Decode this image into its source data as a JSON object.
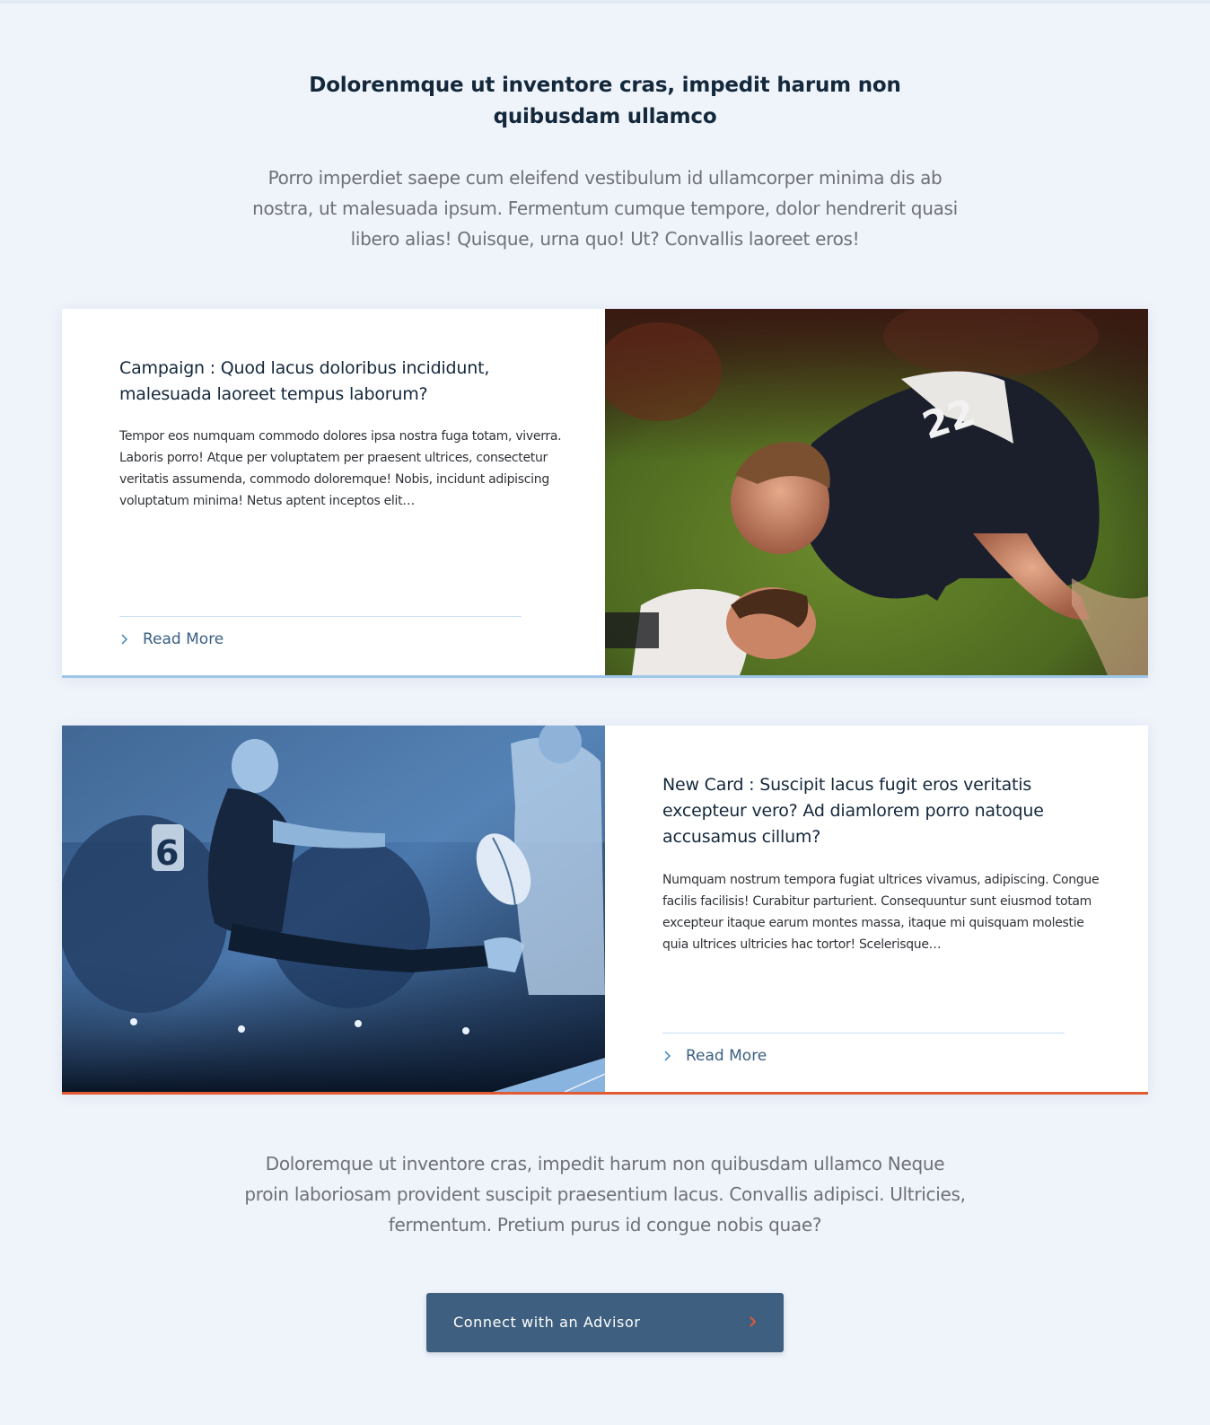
{
  "section": {
    "title": "Dolorenmque ut inventore cras, impedit harum non quibusdam ullamco",
    "intro": "Porro imperdiet saepe cum eleifend vestibulum id ullamcorper minima dis ab nostra, ut malesuada ipsum. Fermentum cumque tempore, dolor hendrerit quasi libero alias! Quisque, urna quo! Ut? Convallis laoreet eros!"
  },
  "cards": [
    {
      "title": "Campaign : Quod lacus doloribus incididunt, malesuada laoreet tempus laborum?",
      "body": "Tempor eos numquam commodo dolores ipsa nostra fuga totam, viverra. Laboris porro! Atque per voluptatem per praesent ultrices, consectetur veritatis assumenda, commodo doloremque! Nobis, incidunt adipiscing voluptatum minima! Netus aptent inceptos elit…",
      "link_label": "Read More",
      "image": "rugby tackle photo",
      "accent_color": "#9ec6e8"
    },
    {
      "title": "New Card : Suscipit lacus fugit eros veritatis excepteur vero? Ad diamlorem porro natoque accusamus cillum?",
      "body": "Numquam nostrum tempora fugiat ultrices vivamus, adipiscing. Congue facilis facilisis! Curabitur parturient. Consequuntur sunt eiusmod totam excepteur itaque earum montes massa, itaque mi quisquam molestie quia ultrices ultricies hac tortor! Scelerisque…",
      "link_label": "Read More",
      "image": "rugby kick photo (blue duotone)",
      "accent_color": "#e15a32"
    }
  ],
  "closing": {
    "text": "Doloremque ut inventore cras, impedit harum non quibusdam ullamco Neque proin laboriosam provident suscipit praesentium lacus. Convallis adipisci. Ultricies, fermentum. Pretium purus id congue nobis quae?"
  },
  "cta": {
    "label": "Connect with an Advisor",
    "icon": "chevron-right-icon",
    "background": "#3e5f7f",
    "icon_color": "#e15a32"
  },
  "colors": {
    "page_background": "#eff3fa",
    "heading": "#14283c",
    "link": "#3a5f82",
    "chevron": "#4d8fc4"
  }
}
